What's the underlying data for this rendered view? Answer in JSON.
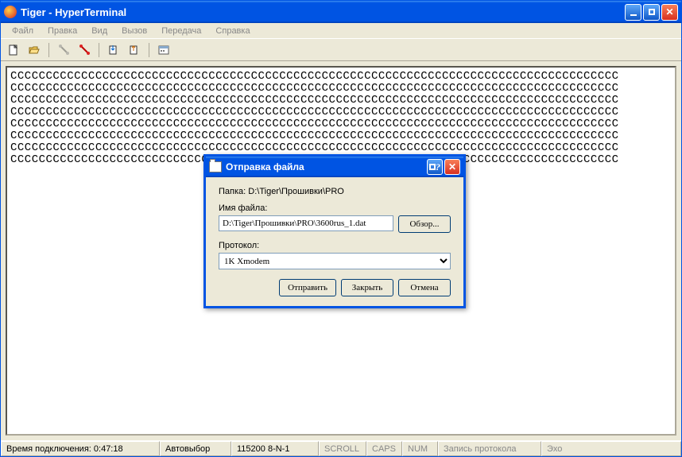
{
  "window": {
    "title": "Tiger - HyperTerminal"
  },
  "menu": {
    "file": "Файл",
    "edit": "Правка",
    "view": "Вид",
    "call": "Вызов",
    "transfer": "Передача",
    "help": "Справка"
  },
  "terminal": {
    "line": "CCCCCCCCCCCCCCCCCCCCCCCCCCCCCCCCCCCCCCCCCCCCCCCCCCCCCCCCCCCCCCCCCCCCCCCCCCCCCCCCCCCCCC"
  },
  "status": {
    "conn_time_label": "Время подключения: 0:47:18",
    "autodetect": "Автовыбор",
    "params": "115200 8-N-1",
    "scroll": "SCROLL",
    "caps": "CAPS",
    "num": "NUM",
    "log": "Запись протокола",
    "echo": "Эхо"
  },
  "dialog": {
    "title": "Отправка файла",
    "folder_label": "Папка: D:\\Tiger\\Прошивки\\PRO",
    "filename_label": "Имя файла:",
    "filename_value": "D:\\Tiger\\Прошивки\\PRO\\3600rus_1.dat",
    "browse": "Обзор...",
    "protocol_label": "Протокол:",
    "protocol_value": "1K Xmodem",
    "send": "Отправить",
    "close": "Закрыть",
    "cancel": "Отмена"
  }
}
